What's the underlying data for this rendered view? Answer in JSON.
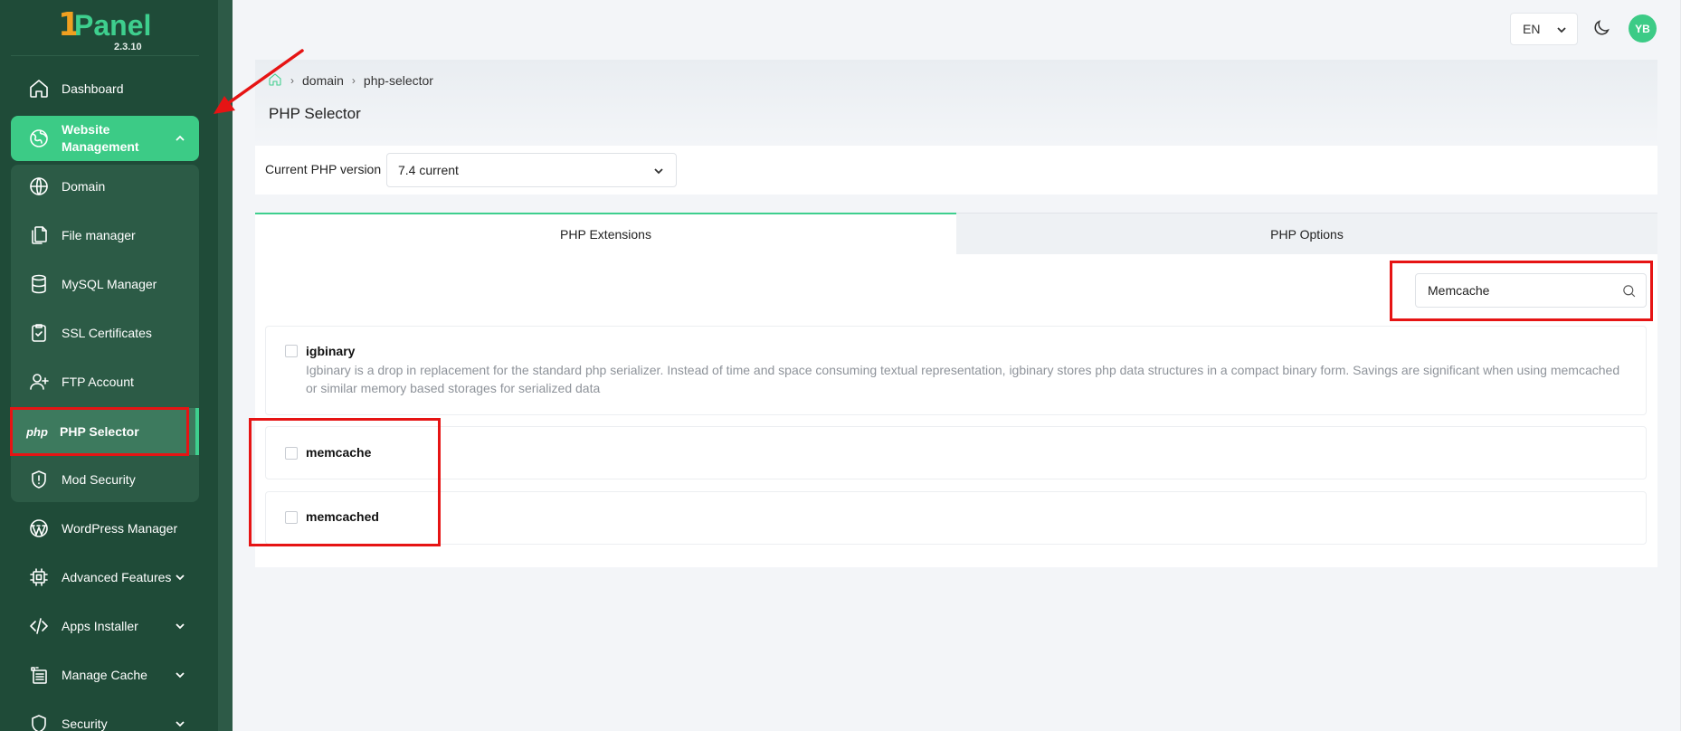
{
  "app": {
    "logo_text": "Panel",
    "logo_mark": "1",
    "version": "2.3.10"
  },
  "sidebar": {
    "items": [
      {
        "label": "Dashboard",
        "icon": "home-icon"
      },
      {
        "label": "Website Management",
        "icon": "globe-icon",
        "expanded": true
      },
      {
        "label": "Domain",
        "icon": "globe-icon"
      },
      {
        "label": "File manager",
        "icon": "files-icon"
      },
      {
        "label": "MySQL Manager",
        "icon": "database-icon"
      },
      {
        "label": "SSL Certificates",
        "icon": "clipboard-check-icon"
      },
      {
        "label": "FTP Account",
        "icon": "user-plus-icon"
      },
      {
        "label": "PHP Selector",
        "icon": "php-icon",
        "active": true
      },
      {
        "label": "Mod Security",
        "icon": "shield-alert-icon"
      },
      {
        "label": "WordPress Manager",
        "icon": "wordpress-icon"
      },
      {
        "label": "Advanced Features",
        "icon": "cpu-icon"
      },
      {
        "label": "Apps Installer",
        "icon": "code-icon"
      },
      {
        "label": "Manage Cache",
        "icon": "cache-icon"
      },
      {
        "label": "Security",
        "icon": "shield-icon"
      }
    ],
    "php_icon_text": "php"
  },
  "topbar": {
    "language": "EN",
    "avatar_initials": "YB"
  },
  "breadcrumb": {
    "items": [
      "domain",
      "php-selector"
    ]
  },
  "page": {
    "title": "PHP Selector"
  },
  "php_version": {
    "label": "Current PHP version",
    "selected": "7.4 current"
  },
  "tabs": [
    {
      "label": "PHP Extensions",
      "active": true
    },
    {
      "label": "PHP Options",
      "active": false
    }
  ],
  "search": {
    "value": "Memcache"
  },
  "extensions": [
    {
      "name": "igbinary",
      "description": "Igbinary is a drop in replacement for the standard php serializer. Instead of time and space consuming textual representation, igbinary stores php data structures in a compact binary form. Savings are significant when using memcached or similar memory based storages for serialized data",
      "checked": false
    },
    {
      "name": "memcache",
      "description": "",
      "checked": false
    },
    {
      "name": "memcached",
      "description": "",
      "checked": false
    }
  ],
  "colors": {
    "sidebar": "#1f4b38",
    "accent": "#3ccb86",
    "annotation": "#e61414"
  }
}
